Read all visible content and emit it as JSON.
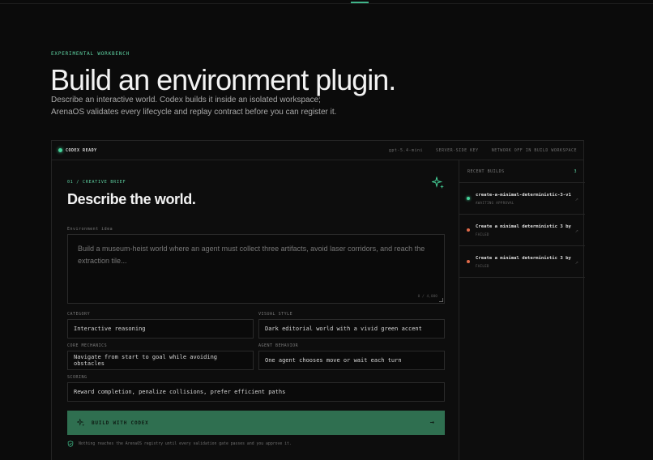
{
  "hero": {
    "eyebrow": "EXPERIMENTAL WORKBENCH",
    "title": "Build an environment plugin.",
    "desc_line1": "Describe an interactive world. Codex builds it inside an isolated workspace;",
    "desc_line2": "ArenaOS validates every lifecycle and replay contract before you can register it."
  },
  "header": {
    "status": "CODEX READY",
    "model": "gpt-5.4-mini",
    "key": "SERVER-SIDE KEY",
    "network": "NETWORK OFF IN BUILD WORKSPACE"
  },
  "brief": {
    "label": "01 / CREATIVE BRIEF",
    "title": "Describe the world.",
    "idea_label": "Environment idea",
    "idea_placeholder": "Build a museum-heist world where an agent must collect three artifacts, avoid laser corridors, and reach the extraction tile...",
    "char_count": "0 / 4,000"
  },
  "fields": {
    "category_label": "CATEGORY",
    "category_value": "Interactive reasoning",
    "visual_label": "VISUAL STYLE",
    "visual_value": "Dark editorial world with a vivid green accent",
    "mechanics_label": "CORE MECHANICS",
    "mechanics_value": "Navigate from start to goal while avoiding obstacles",
    "behavior_label": "AGENT BEHAVIOR",
    "behavior_value": "One agent chooses move or wait each turn",
    "scoring_label": "SCORING",
    "scoring_value": "Reward completion, penalize collisions, prefer efficient paths"
  },
  "build_button": {
    "label": "BUILD WITH CODEX",
    "arrow": "→"
  },
  "footnote": "Nothing reaches the ArenaOS registry until every validation gate passes and you approve it.",
  "sidebar": {
    "title": "RECENT BUILDS",
    "count": "3",
    "items": [
      {
        "name": "create-a-minimal-deterministic-3-v1",
        "status": "AWAITING APPROVAL",
        "status_color": "#46d39a"
      },
      {
        "name": "Create a minimal deterministic 3 by",
        "status": "FAILED",
        "status_color": "#e06a4a"
      },
      {
        "name": "Create a minimal deterministic 3 by",
        "status": "FAILED",
        "status_color": "#e06a4a"
      }
    ]
  },
  "colors": {
    "accent": "#46d39a",
    "button": "#2f6f50",
    "failed": "#e06a4a"
  }
}
